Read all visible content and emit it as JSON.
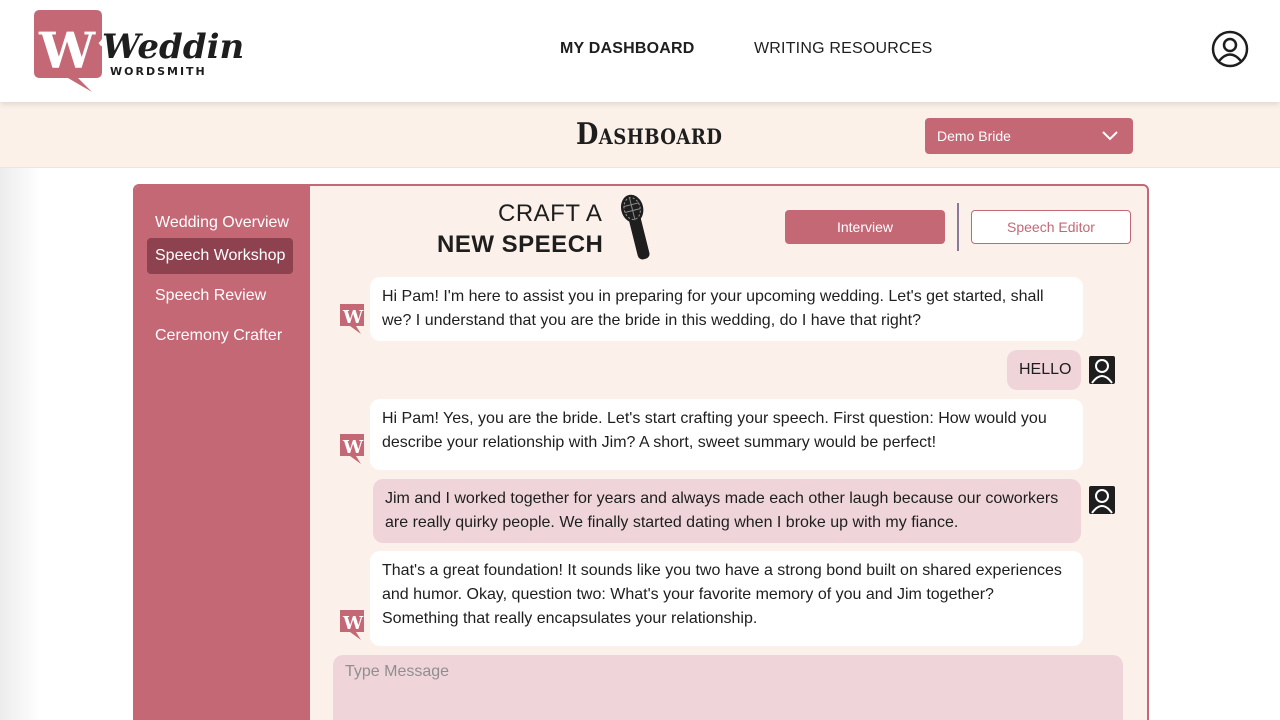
{
  "brand": {
    "mark": "W”",
    "name": "Wedding",
    "sub": "WORDSMITH"
  },
  "nav": {
    "dashboard": "MY DASHBOARD",
    "resources": "WRITING RESOURCES"
  },
  "page": {
    "title": "Dashboard",
    "selected_user": "Demo Bride"
  },
  "sidebar": {
    "items": [
      {
        "label": "Wedding Overview"
      },
      {
        "label": "Speech Workshop"
      },
      {
        "label": "Speech Review"
      },
      {
        "label": "Ceremony Crafter"
      }
    ],
    "active": "Speech Workshop"
  },
  "workshop": {
    "heading_line1": "CRAFT A",
    "heading_line2": "NEW SPEECH",
    "interview_label": "Interview",
    "editor_label": "Speech Editor"
  },
  "chat": {
    "messages": [
      {
        "from": "assistant",
        "text": "Hi Pam! I'm here to assist you in preparing for your upcoming wedding. Let's get started, shall we? I understand that you are the bride in this wedding, do I have that right?"
      },
      {
        "from": "user",
        "text": "HELLO"
      },
      {
        "from": "assistant",
        "text": "Hi Pam! Yes, you are the bride. Let's start crafting your speech. First question: How would you describe your relationship with Jim? A short, sweet summary would be perfect!"
      },
      {
        "from": "user",
        "text": "Jim and I worked together for years and always made each other laugh because our coworkers are really quirky people. We finally started dating when I broke up with my fiance."
      },
      {
        "from": "assistant",
        "text": "That's a great foundation! It sounds like you two have a strong bond built on shared experiences and humor. Okay, question two: What's your favorite memory of you and Jim together? Something that really encapsulates your relationship."
      }
    ],
    "input_placeholder": "Type Message"
  },
  "colors": {
    "accent": "#c46876",
    "accent_dark": "#8e4250",
    "cream": "#fcf1ea",
    "user_bubble": "#efd5da"
  },
  "icons": {
    "account": "user-circle-icon",
    "dropdown": "chevron-down-icon",
    "mic": "microphone-icon",
    "user_avatar": "person-icon",
    "bot_avatar": "wordsmith-logo-icon"
  }
}
